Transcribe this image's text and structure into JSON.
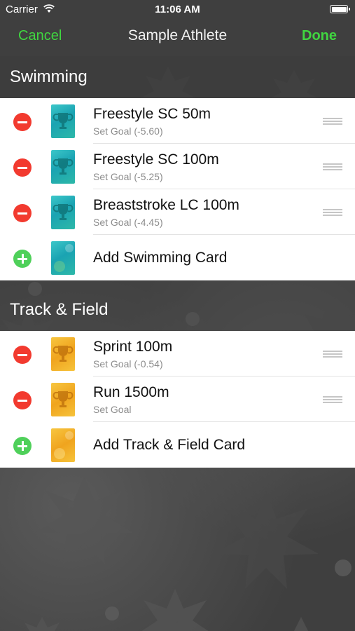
{
  "status": {
    "carrier": "Carrier",
    "time": "11:06 AM"
  },
  "nav": {
    "cancel": "Cancel",
    "title": "Sample Athlete",
    "done": "Done",
    "accent_color": "#40d640"
  },
  "sections": [
    {
      "title": "Swimming",
      "cards": [
        {
          "title": "Freestyle SC 50m",
          "subtitle": "Set Goal (-5.60)"
        },
        {
          "title": "Freestyle SC 100m",
          "subtitle": "Set Goal (-5.25)"
        },
        {
          "title": "Breaststroke LC 100m",
          "subtitle": "Set Goal (-4.45)"
        }
      ],
      "add_label": "Add Swimming Card",
      "card_color": "#1aa3b2"
    },
    {
      "title": "Track & Field",
      "cards": [
        {
          "title": "Sprint 100m",
          "subtitle": "Set Goal (-0.54)"
        },
        {
          "title": "Run 1500m",
          "subtitle": "Set Goal"
        }
      ],
      "add_label": "Add Track & Field Card",
      "card_color": "#f0a41e"
    }
  ],
  "icons": {
    "delete": "minus-circle-icon",
    "add": "plus-circle-icon",
    "reorder": "reorder-handle-icon",
    "card": "trophy-card-icon"
  },
  "colors": {
    "delete": "#f23a2f",
    "add": "#4fd05a"
  }
}
